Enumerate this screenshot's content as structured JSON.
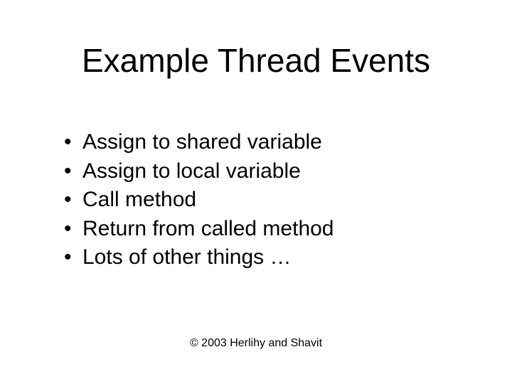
{
  "title": "Example Thread Events",
  "bullets": [
    "Assign to shared variable",
    "Assign to local variable",
    "Call method",
    "Return from called method",
    "Lots of other things …"
  ],
  "footer": "© 2003 Herlihy and Shavit"
}
